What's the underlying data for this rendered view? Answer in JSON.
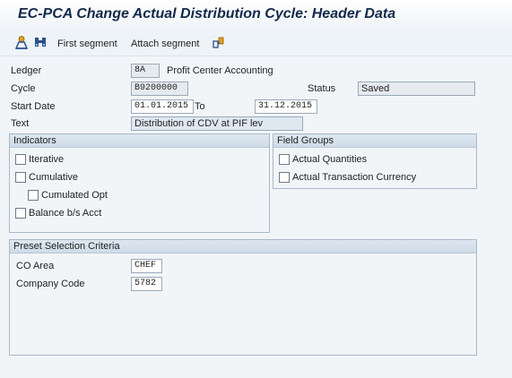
{
  "title": "EC-PCA Change Actual Distribution Cycle: Header Data",
  "toolbar": {
    "first_segment": "First segment",
    "attach_segment": "Attach segment"
  },
  "header": {
    "ledger_label": "Ledger",
    "ledger_value": "8A",
    "ledger_desc": "Profit Center Accounting",
    "cycle_label": "Cycle",
    "cycle_value": "B9200000",
    "status_label": "Status",
    "status_value": "Saved",
    "start_date_label": "Start Date",
    "start_date_value": "01.01.2015",
    "to_label": "To",
    "end_date_value": "31.12.2015",
    "text_label": "Text",
    "text_value": "Distribution of CDV at PIF lev"
  },
  "indicators": {
    "title": "Indicators",
    "iterative": "Iterative",
    "cumulative": "Cumulative",
    "cumulated_opt": "Cumulated Opt",
    "balance": "Balance b/s Acct"
  },
  "field_groups": {
    "title": "Field Groups",
    "actual_quantities": "Actual Quantities",
    "actual_currency": "Actual Transaction Currency"
  },
  "preset": {
    "title": "Preset Selection Criteria",
    "co_area_label": "CO Area",
    "co_area_value": "CHEF",
    "company_code_label": "Company Code",
    "company_code_value": "5782"
  },
  "colors": {
    "title_text": "#13294a",
    "group_header": "#d6e1ec",
    "background": "#f2f5f8"
  }
}
